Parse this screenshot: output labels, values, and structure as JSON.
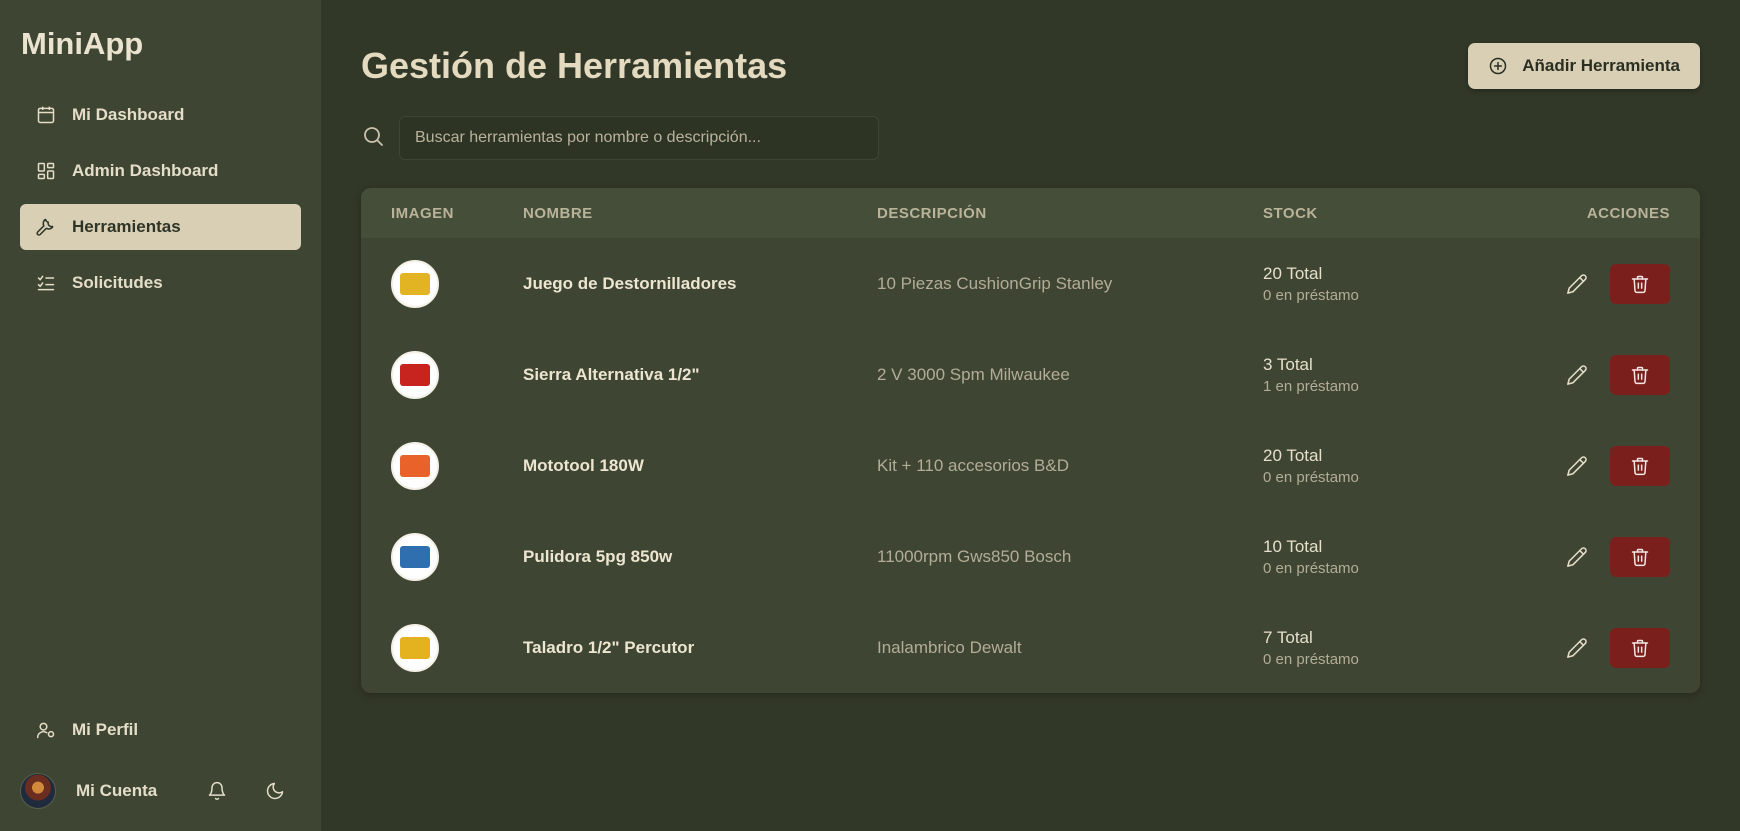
{
  "app": {
    "brand": "MiniApp"
  },
  "sidebar": {
    "items": [
      {
        "label": "Mi Dashboard",
        "icon": "calendar-icon"
      },
      {
        "label": "Admin Dashboard",
        "icon": "grid-icon"
      },
      {
        "label": "Herramientas",
        "icon": "wrench-icon",
        "active": true
      },
      {
        "label": "Solicitudes",
        "icon": "checklist-icon"
      }
    ],
    "profile_label": "Mi Perfil",
    "account_label": "Mi Cuenta"
  },
  "header": {
    "title": "Gestión de Herramientas",
    "add_button_label": "Añadir Herramienta"
  },
  "search": {
    "placeholder": "Buscar herramientas por nombre o descripción...",
    "value": ""
  },
  "table": {
    "columns": [
      "IMAGEN",
      "NOMBRE",
      "DESCRIPCIÓN",
      "STOCK",
      "ACCIONES"
    ],
    "rows": [
      {
        "name": "Juego de Destornilladores",
        "description": "10 Piezas CushionGrip Stanley",
        "stock_total": "20 Total",
        "stock_loan": "0 en préstamo",
        "thumb_color": "#e2b323"
      },
      {
        "name": "Sierra Alternativa 1/2\"",
        "description": "2 V 3000 Spm Milwaukee",
        "stock_total": "3 Total",
        "stock_loan": "1 en préstamo",
        "thumb_color": "#c8241f"
      },
      {
        "name": "Mototool 180W",
        "description": "Kit + 110 accesorios B&D",
        "stock_total": "20 Total",
        "stock_loan": "0 en préstamo",
        "thumb_color": "#e8622a"
      },
      {
        "name": "Pulidora 5pg 850w",
        "description": "11000rpm Gws850 Bosch",
        "stock_total": "10 Total",
        "stock_loan": "0 en préstamo",
        "thumb_color": "#2f6fb0"
      },
      {
        "name": "Taladro 1/2\" Percutor",
        "description": "Inalambrico Dewalt",
        "stock_total": "7 Total",
        "stock_loan": "0 en préstamo",
        "thumb_color": "#e4b21f"
      }
    ]
  },
  "colors": {
    "sidebar_bg": "#3e4633",
    "main_bg": "#323828",
    "accent": "#d8cfb5",
    "danger": "#7b1f1c"
  }
}
